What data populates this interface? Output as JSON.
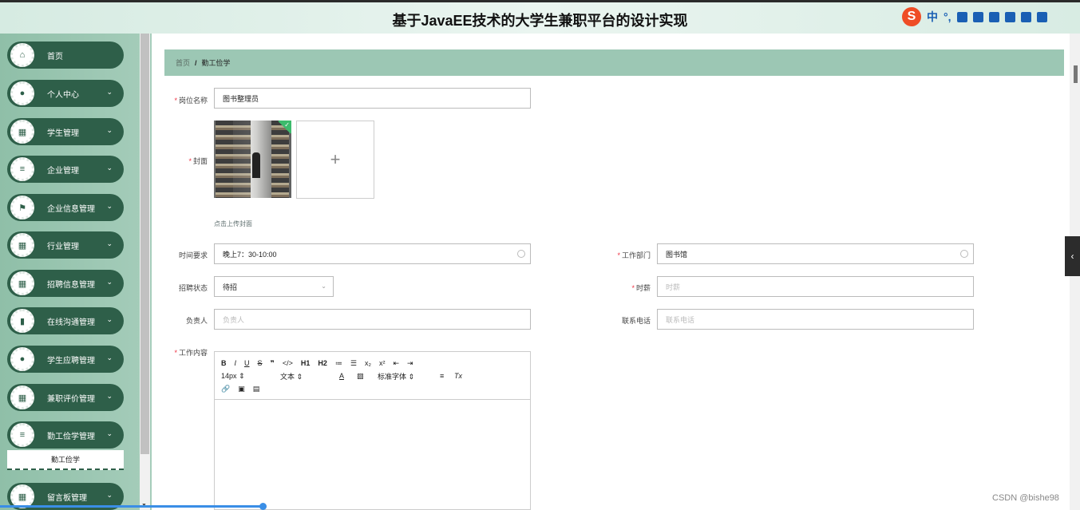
{
  "header": {
    "title": "基于JavaEE技术的大学生兼职平台的设计实现"
  },
  "ime": {
    "logo": "S",
    "mode": "中",
    "punct": "°,"
  },
  "sidebar": {
    "items": [
      {
        "label": "首页",
        "icon": "home-icon",
        "glyph": "⌂",
        "expandable": false
      },
      {
        "label": "个人中心",
        "icon": "user-icon",
        "glyph": "●",
        "expandable": true
      },
      {
        "label": "学生管理",
        "icon": "grid-icon",
        "glyph": "▦",
        "expandable": true
      },
      {
        "label": "企业管理",
        "icon": "list-icon",
        "glyph": "≡",
        "expandable": true
      },
      {
        "label": "企业信息管理",
        "icon": "flag-icon",
        "glyph": "⚑",
        "expandable": true
      },
      {
        "label": "行业管理",
        "icon": "grid-icon",
        "glyph": "▦",
        "expandable": true
      },
      {
        "label": "招聘信息管理",
        "icon": "grid-icon",
        "glyph": "▦",
        "expandable": true
      },
      {
        "label": "在线沟通管理",
        "icon": "chart-icon",
        "glyph": "▮",
        "expandable": true
      },
      {
        "label": "学生应聘管理",
        "icon": "user-icon",
        "glyph": "●",
        "expandable": true
      },
      {
        "label": "兼职评价管理",
        "icon": "grid-icon",
        "glyph": "▦",
        "expandable": true
      },
      {
        "label": "勤工俭学管理",
        "icon": "list-icon",
        "glyph": "≡",
        "expandable": true
      },
      {
        "label": "留言板管理",
        "icon": "grid-icon",
        "glyph": "▦",
        "expandable": true
      }
    ],
    "submenu_label": "勤工俭学"
  },
  "breadcrumb": {
    "home": "首页",
    "separator": "/",
    "current": "勤工俭学"
  },
  "form": {
    "position_name": {
      "label": "岗位名称",
      "value": "图书整理员"
    },
    "cover": {
      "label": "封面",
      "hint": "点击上传封面",
      "plus": "+"
    },
    "time_req": {
      "label": "时间要求",
      "value": "晚上7：30-10:00"
    },
    "department": {
      "label": "工作部门",
      "value": "图书馆"
    },
    "status": {
      "label": "招聘状态",
      "value": "待招"
    },
    "salary": {
      "label": "时薪",
      "placeholder": "时薪"
    },
    "manager": {
      "label": "负责人",
      "placeholder": "负责人"
    },
    "phone": {
      "label": "联系电话",
      "placeholder": "联系电话"
    },
    "content": {
      "label": "工作内容"
    }
  },
  "editor_toolbar": {
    "row1": [
      "B",
      "I",
      "U",
      "S",
      "❞",
      "</>",
      "H1",
      "H2",
      "≔",
      "☰",
      "x₂",
      "x²",
      "⇤",
      "⇥"
    ],
    "font_size": "14px",
    "text_type": "文本",
    "font_family": "标准字体",
    "row3": [
      "🔗",
      "▣",
      "▤"
    ]
  },
  "side_toggle": "‹",
  "watermark": "CSDN @bishe98",
  "colors": {
    "sidebar_item": "#2e5f49",
    "breadcrumb_bg": "#9cc7b4",
    "required": "#ee3344"
  }
}
